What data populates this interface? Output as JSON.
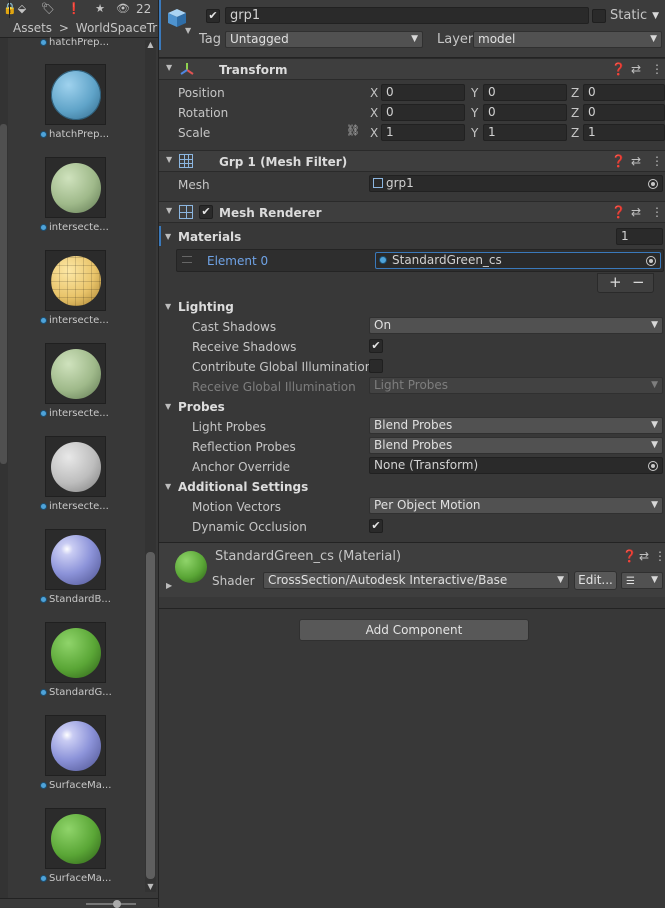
{
  "project": {
    "toolbar": {
      "hidden_count": "22"
    },
    "breadcrumb": {
      "root": "Assets",
      "separator": ">",
      "folder": "WorldSpaceTra"
    },
    "assets": [
      {
        "name": "hatchPrep..."
      },
      {
        "name": "intersecte...",
        "color": "#9fb98a"
      },
      {
        "name": "intersecte...",
        "color": "#e9c46a"
      },
      {
        "name": "intersecte...",
        "color": "#9fb98a"
      },
      {
        "name": "intersecte...",
        "color": "#bdbdbd"
      },
      {
        "name": "StandardB...",
        "color": "#8c93d9"
      },
      {
        "name": "StandardG...",
        "color": "#5aa636"
      },
      {
        "name": "SurfaceMa...",
        "color": "#8c93d9"
      },
      {
        "name": "SurfaceMa...",
        "color": "#5aa636"
      }
    ],
    "top_caption": "hatchPrep..."
  },
  "inspector": {
    "object_name": "grp1",
    "static_label": "Static",
    "tag_label": "Tag",
    "tag_value": "Untagged",
    "layer_label": "Layer",
    "layer_value": "model",
    "transform": {
      "title": "Transform",
      "position": {
        "label": "Position",
        "x": "0",
        "y": "0",
        "z": "0"
      },
      "rotation": {
        "label": "Rotation",
        "x": "0",
        "y": "0",
        "z": "0"
      },
      "scale": {
        "label": "Scale",
        "x": "1",
        "y": "1",
        "z": "1"
      },
      "axis_x": "X",
      "axis_y": "Y",
      "axis_z": "Z"
    },
    "mesh_filter": {
      "title": "Grp 1 (Mesh Filter)",
      "mesh_label": "Mesh",
      "mesh_value": "grp1"
    },
    "mesh_renderer": {
      "title": "Mesh Renderer",
      "materials_label": "Materials",
      "materials_count": "1",
      "element_label": "Element 0",
      "element_value": "StandardGreen_cs",
      "plus": "+",
      "minus": "−",
      "lighting": "Lighting",
      "cast_shadows_label": "Cast Shadows",
      "cast_shadows_value": "On",
      "receive_shadows_label": "Receive Shadows",
      "contribute_gi_label": "Contribute Global Illumination",
      "receive_gi_label": "Receive Global Illumination",
      "receive_gi_value": "Light Probes",
      "probes": "Probes",
      "light_probes_label": "Light Probes",
      "light_probes_value": "Blend Probes",
      "reflection_probes_label": "Reflection Probes",
      "reflection_probes_value": "Blend Probes",
      "anchor_override_label": "Anchor Override",
      "anchor_override_value": "None (Transform)",
      "additional": "Additional Settings",
      "motion_vectors_label": "Motion Vectors",
      "motion_vectors_value": "Per Object Motion",
      "dynamic_occlusion_label": "Dynamic Occlusion"
    },
    "material": {
      "title": "StandardGreen_cs (Material)",
      "shader_label": "Shader",
      "shader_value": "CrossSection/Autodesk Interactive/Base",
      "edit_label": "Edit..."
    },
    "add_component": "Add Component",
    "colors": {
      "accent": "#3a79bb",
      "element_text": "#6fa3e6",
      "panel": "#383838"
    }
  }
}
